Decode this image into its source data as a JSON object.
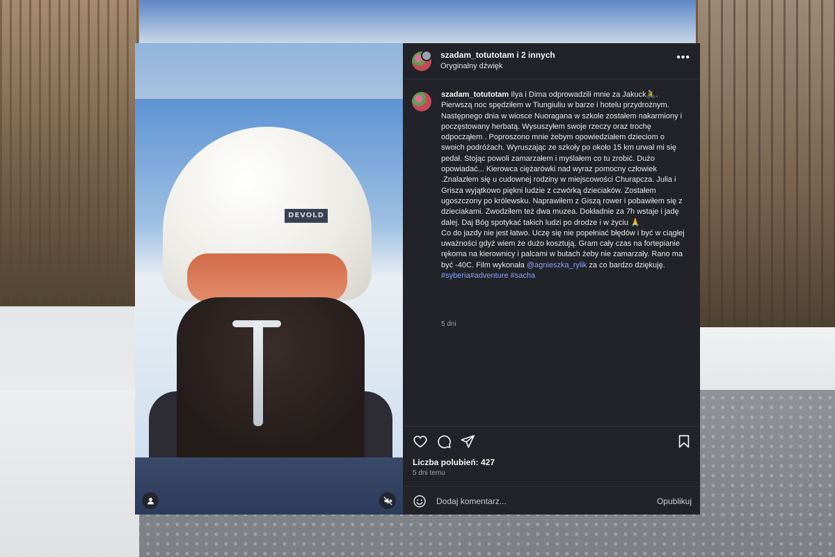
{
  "post": {
    "header": {
      "username": "szadam_totutotam i 2 innych",
      "subtitle": "Oryginalny dźwięk",
      "more_icon": "more-horizontal-icon"
    },
    "media": {
      "hat_label": "DEVOLD",
      "user_tag_icon": "user-tag-icon",
      "mute_icon": "muted-speaker-icon"
    },
    "caption": {
      "username": "szadam_totutotam",
      "paragraph1": "Ilya i Dima odprowadzili mnie za Jakuck🚴. Pierwszą noc spędziłem w Tiungiuliu w barze i hotelu przydrożnym. Następnego dnia w wiosce Nuoragana w szkole zostałem nakarmiony i poczęstowany herbatą. Wysuszyłem swoje rzeczy oraz trochę odpocząłem . Poproszono mnie żebym opowiedziałem dzieciom o swoich podróżach. Wyruszając ze szkoły po około 15 km urwał mi się pedał. Stojąc powoli zamarzałem i myślałem co tu zrobić. Dużo opowiadać... Kierowca ciężarówki nad wyraz pomocny człowiek .Znalazłem się u cudownej rodziny w miejscowości Churapcza. Julia i Grisza wyjątkowo piękni ludzie z czwórką dzieciaków. Zostałem ugoszczony po królewsku. Naprawiłem z Giszą rower i pobawiłem się z dzieciakami. Zwodziłem też dwa muzea. Dokładnie za 7h wstaje i jadę dalej. Daj Bóg spotykać takich ludzi po drodze i w życiu 🙏",
      "paragraph2_text": "Co do jazdy nie jest łatwo. Uczę się nie popełniać błędów i być w ciągłej uważności gdyż wiem że dużo kosztują. Gram cały czas na fortepianie rękoma na kierownicy i palcami w butach żeby nie zamarzały. Rano ma być -40C. Film wykonała",
      "mention": "@agnieszka_rylik",
      "paragraph2_tail": "za co bardzo dziękuję.",
      "hashtags": "#syberia#adventure #sacha",
      "time": "5 dni"
    },
    "actions": {
      "like_icon": "heart-icon",
      "comment_icon": "comment-icon",
      "share_icon": "paper-plane-icon",
      "save_icon": "bookmark-icon"
    },
    "likes_text": "Liczba polubień: 427",
    "posted_ago": "5 dni temu",
    "comment_box": {
      "emoji_icon": "smiley-icon",
      "placeholder": "Dodaj komentarz...",
      "publish_label": "Opublikuj"
    }
  },
  "colors": {
    "panel_bg": "#212328",
    "link": "#8ea2ff"
  }
}
